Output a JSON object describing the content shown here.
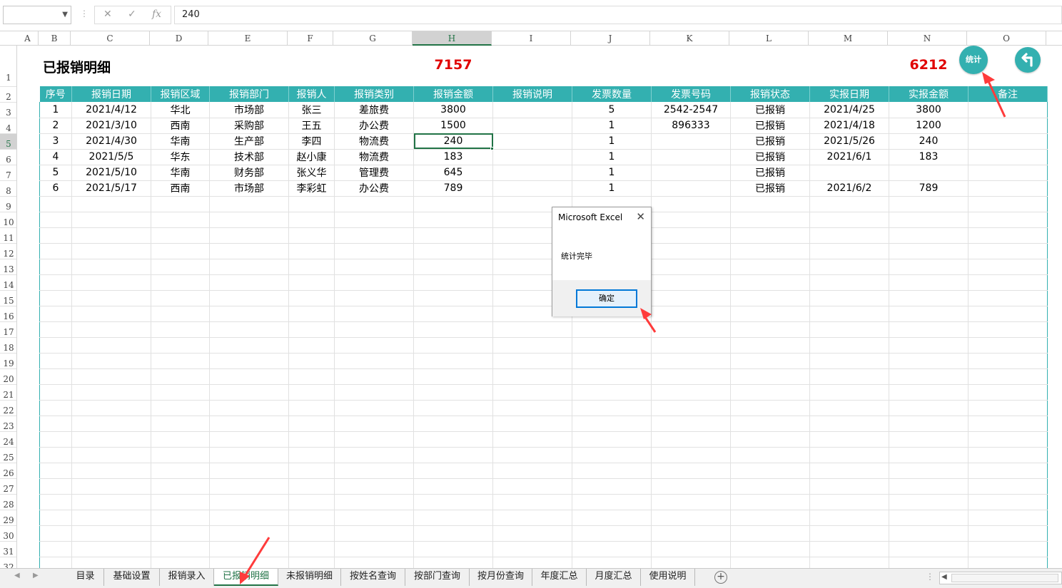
{
  "formula_bar": {
    "name_box": "",
    "cancel_icon": "✕",
    "enter_icon": "✓",
    "fx_label": "fx",
    "value": "240"
  },
  "columns": [
    "A",
    "B",
    "C",
    "D",
    "E",
    "F",
    "G",
    "H",
    "I",
    "J",
    "K",
    "L",
    "M",
    "N",
    "O"
  ],
  "selected_column": "H",
  "rows": [
    "1",
    "2",
    "3",
    "4",
    "5",
    "6",
    "7",
    "8",
    "9",
    "10",
    "11",
    "12",
    "13",
    "14",
    "15",
    "16",
    "17",
    "18",
    "19",
    "20",
    "21",
    "22",
    "23",
    "24",
    "25",
    "26",
    "27",
    "28",
    "29",
    "30",
    "31",
    "32"
  ],
  "selected_row": "5",
  "sheet": {
    "title": "已报销明细",
    "total_amount": "7157",
    "total_actual": "6212",
    "stat_button": "统计",
    "back_icon": "undo-arrow"
  },
  "table": {
    "headers": [
      "序号",
      "报销日期",
      "报销区域",
      "报销部门",
      "报销人",
      "报销类别",
      "报销金额",
      "报销说明",
      "发票数量",
      "发票号码",
      "报销状态",
      "实报日期",
      "实报金额",
      "备注"
    ],
    "rows": [
      [
        "1",
        "2021/4/12",
        "华北",
        "市场部",
        "张三",
        "差旅费",
        "3800",
        "",
        "5",
        "2542-2547",
        "已报销",
        "2021/4/25",
        "3800",
        ""
      ],
      [
        "2",
        "2021/3/10",
        "西南",
        "采购部",
        "王五",
        "办公费",
        "1500",
        "",
        "1",
        "896333",
        "已报销",
        "2021/4/18",
        "1200",
        ""
      ],
      [
        "3",
        "2021/4/30",
        "华南",
        "生产部",
        "李四",
        "物流费",
        "240",
        "",
        "1",
        "",
        "已报销",
        "2021/5/26",
        "240",
        ""
      ],
      [
        "4",
        "2021/5/5",
        "华东",
        "技术部",
        "赵小康",
        "物流费",
        "183",
        "",
        "1",
        "",
        "已报销",
        "2021/6/1",
        "183",
        ""
      ],
      [
        "5",
        "2021/5/10",
        "华南",
        "财务部",
        "张义华",
        "管理费",
        "645",
        "",
        "1",
        "",
        "已报销",
        "",
        "",
        ""
      ],
      [
        "6",
        "2021/5/17",
        "西南",
        "市场部",
        "李彩虹",
        "办公费",
        "789",
        "",
        "1",
        "",
        "已报销",
        "2021/6/2",
        "789",
        ""
      ]
    ]
  },
  "dialog": {
    "title": "Microsoft Excel",
    "close_icon": "✕",
    "message": "统计完毕",
    "ok_label": "确定"
  },
  "tabs": [
    "目录",
    "基础设置",
    "报销录入",
    "已报销明细",
    "未报销明细",
    "按姓名查询",
    "按部门查询",
    "按月份查询",
    "年度汇总",
    "月度汇总",
    "使用说明"
  ],
  "active_tab": "已报销明细",
  "add_sheet_icon": "+",
  "colors": {
    "accent": "#33b0b0",
    "excel_green": "#217346",
    "red": "#e00000",
    "arrow": "#ff3b3b"
  }
}
